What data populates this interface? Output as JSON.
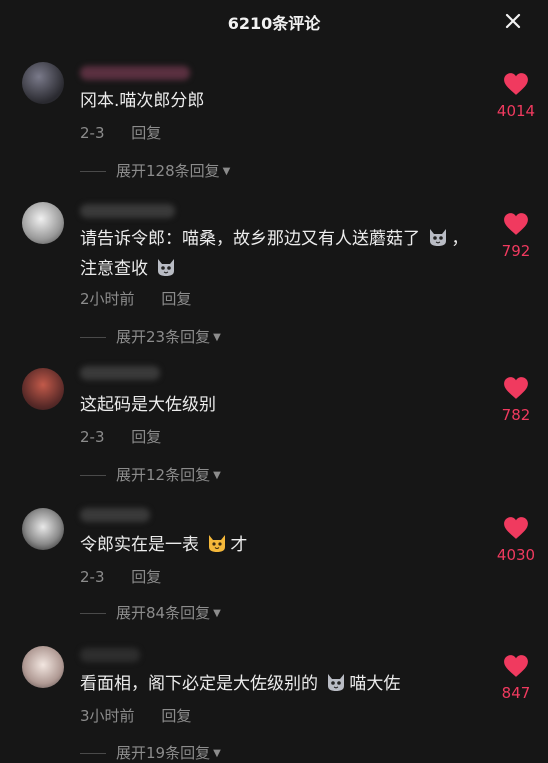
{
  "header": {
    "title": "6210条评论",
    "close_icon": "close-icon"
  },
  "comments": [
    {
      "text_parts": [
        "冈本.喵次郎分郎"
      ],
      "meta_time": "2-3",
      "reply_label": "回复",
      "expand_label": "展开128条回复",
      "likes": "4014"
    },
    {
      "text_parts": [
        "请告诉令郎：喵桑，故乡那边又有人送蘑菇了",
        "，注意查收"
      ],
      "meta_time": "2小时前",
      "reply_label": "回复",
      "expand_label": "展开23条回复",
      "likes": "792"
    },
    {
      "text_parts": [
        "这起码是大佐级别"
      ],
      "meta_time": "2-3",
      "reply_label": "回复",
      "expand_label": "展开12条回复",
      "likes": "782"
    },
    {
      "text_parts": [
        "令郎实在是一表",
        "才"
      ],
      "meta_time": "2-3",
      "reply_label": "回复",
      "expand_label": "展开84条回复",
      "likes": "4030"
    },
    {
      "text_parts": [
        "看面相，阁下必定是大佐级别的",
        "喵大佐"
      ],
      "meta_time": "3小时前",
      "reply_label": "回复",
      "expand_label": "展开19条回复",
      "likes": "847"
    }
  ],
  "colors": {
    "background": "#161616",
    "like_red": "#f03a5f",
    "muted_text": "#8c8c8c"
  }
}
